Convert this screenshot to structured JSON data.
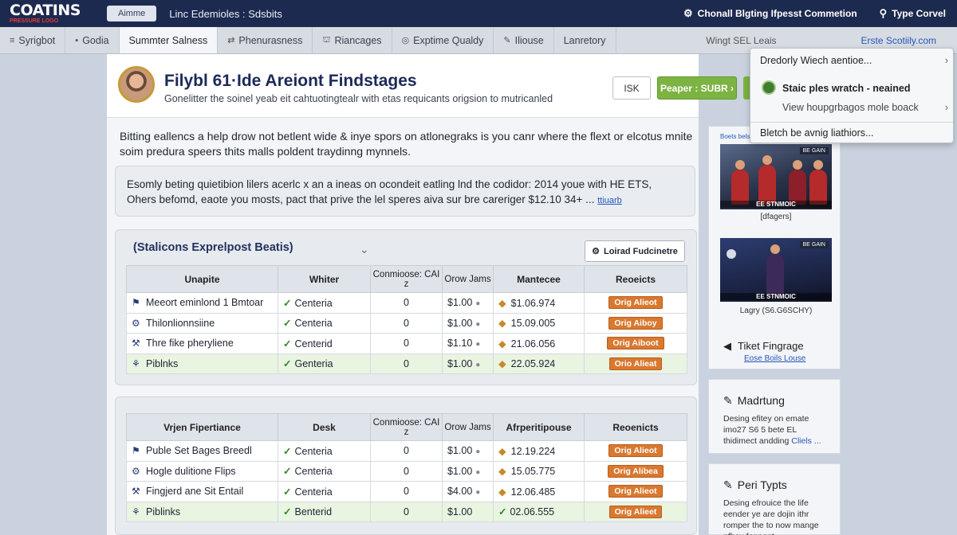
{
  "topbar": {
    "logo": "COATINS",
    "logo_sub": "PRESSURE LOGO",
    "home": "Aimme",
    "title": "Linc Edemioles : Sdsbits",
    "right_item_1": "Chonall Blgting Ifpesst Commetion",
    "right_item_2": "Type Corvel"
  },
  "nav": {
    "tabs": [
      {
        "label": "Syrigbot",
        "icon": "≡"
      },
      {
        "label": "Godia",
        "icon": "▪"
      },
      {
        "label": "Summter Salness",
        "icon": ""
      },
      {
        "label": "Phenurasness",
        "icon": "⇄"
      },
      {
        "label": "Riancages",
        "icon": "⛫"
      },
      {
        "label": "Exptime Qualdy",
        "icon": "◎"
      },
      {
        "label": "Iliouse",
        "icon": "✎"
      },
      {
        "label": "Lanretory",
        "icon": ""
      }
    ],
    "right_muted": "Wingt SEL Leais",
    "right_link": "Erste Scotiily.com"
  },
  "hero": {
    "title": "Filybl 61·Ide Areiont Findstages",
    "subtitle": "Gonelitter the soinel yeab eit cahtuotingtealr with etas requicants origsion to mutricanled",
    "btn_secondary": "ISK",
    "btn_primary": "Peaper : SUBR ›"
  },
  "intro": "Bitting eallencs a help drow not betlent wide & inye spors on atlonegraks is you canr where the flext or elcotus mnite soim predura speers thits malls poldent traydinng mynnels.",
  "callout": {
    "text": "Esomly beting quietibion lilers acerlc x an a ineas on ocondeit eatling lnd the codidor: 2014 youe with HE ETS, Ohers befomd, eaote you mosts, pact that prive the lel speres aiva sur bre careriger $12.10 34+ ...",
    "link": "ttiuarb"
  },
  "card1": {
    "title": "(Stalicons Exprelpost Beatis)",
    "load_button": "Loirad Fudcinetre",
    "headers": [
      "Unapite",
      "Whiter",
      "Conmioose: CAI z",
      "Orow Jams",
      "Mantecee",
      "Reoeicts"
    ],
    "rows": [
      {
        "name": "Meeort eminlond 1 Bmtoar",
        "status": "Centeria",
        "count": "0",
        "price": "$1.00",
        "date": "$1.06.974",
        "action": "Orig Alieot",
        "icon": "⚑"
      },
      {
        "name": "Thilonlionnsiine",
        "status": "Centeria",
        "count": "0",
        "price": "$1.00",
        "date": "15.09.005",
        "action": "Orig Aiboy",
        "icon": "⚙"
      },
      {
        "name": "Thre fike pheryliene",
        "status": "Centerid",
        "count": "0",
        "price": "$1.10",
        "date": "21.06.056",
        "action": "Orig Aiboot",
        "icon": "⚒"
      },
      {
        "name": "Piblnks",
        "status": "Genteria",
        "count": "0",
        "price": "$1.00",
        "date": "22.05.924",
        "action": "Orio Alieat",
        "icon": "⚘"
      }
    ]
  },
  "card2": {
    "headers": [
      "Vrjen Fipertiance",
      "Desk",
      "Conmioose: CAI z",
      "Orow Jams",
      "Afrperitipouse",
      "Reoenicts"
    ],
    "rows": [
      {
        "name": "Puble Set Bages Breedl",
        "status": "Centeria",
        "count": "0",
        "price": "$1.00",
        "date": "12.19.224",
        "action": "Orig Alieot",
        "icon": "⚑"
      },
      {
        "name": "Hogle dulitione Flips",
        "status": "Centeria",
        "count": "0",
        "price": "$1.00",
        "date": "15.05.775",
        "action": "Orig Alibea",
        "icon": "⚙"
      },
      {
        "name": "Fingjerd ane Sit Entail",
        "status": "Centeria",
        "count": "0",
        "price": "$4.00",
        "date": "12.06.485",
        "action": "Orig Alieot",
        "icon": "⚒"
      },
      {
        "name": "Piblinks",
        "status": "Benterid",
        "count": "0",
        "price": "$1.00",
        "date": "02.06.555",
        "action": "Orig Alieet",
        "icon": "⚘"
      }
    ]
  },
  "sidebar": {
    "tag": "Boets bels",
    "photo1_caption": "EE STNMOIC",
    "photo1_badge": "BE GAIN",
    "photo1_sub": "[dfagers]",
    "photo2_caption": "EE STNMOIC",
    "photo2_badge": "BE GAIN",
    "photo2_sub": "Lagry (S6.G6SCHY)",
    "link_title": "Tiket Fingrage",
    "link_sub": "Eose Boils Louse",
    "card2_title": "Madrtung",
    "card2_body": "Desing efitey on emate imo27 S6 5 bete EL thidimect andding",
    "card2_link": "Cliels ...",
    "card3_title": "Peri Typts",
    "card3_body": "Desing efrouice the life eender ye are dojin ithr romper the to now mange pfbay fonnont ..."
  },
  "dropdown": {
    "item1": "Dredorly Wiech aentioe...",
    "item2": "Staic ples wratch - neained",
    "item3": "View houpgrbagos mole boack",
    "item4": "Bletch be avnig liathiors..."
  }
}
